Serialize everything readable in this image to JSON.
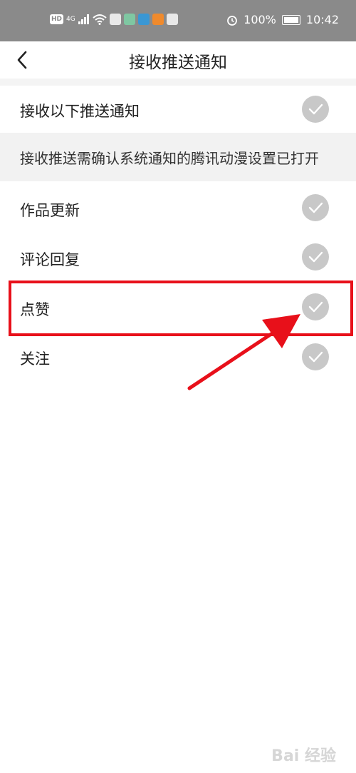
{
  "status_bar": {
    "hd": "HD",
    "network": "4G",
    "battery": "100%",
    "time": "10:42"
  },
  "header": {
    "title": "接收推送通知"
  },
  "master": {
    "label": "接收以下推送通知"
  },
  "notice": {
    "text": "接收推送需确认系统通知的腾讯动漫设置已打开"
  },
  "items": [
    {
      "label": "作品更新"
    },
    {
      "label": "评论回复"
    },
    {
      "label": "点赞"
    },
    {
      "label": "关注"
    }
  ],
  "watermark": "Bai 经验",
  "colors": {
    "highlight": "#e8101a",
    "check": "#c8c8c8"
  }
}
